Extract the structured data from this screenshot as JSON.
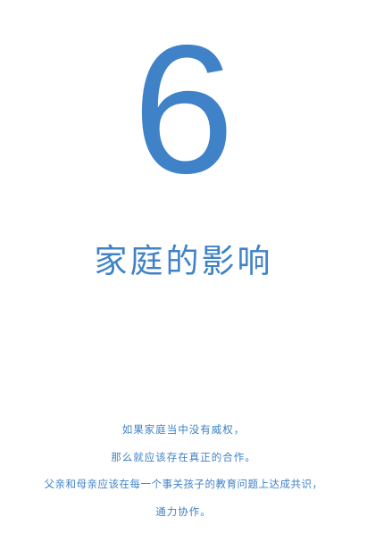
{
  "chapter": {
    "number": "6",
    "title": "家庭的影响"
  },
  "quote": {
    "lines": [
      "如果家庭当中没有威权，",
      "那么就应该存在真正的合作。",
      "父亲和母亲应该在每一个事关孩子的教育问题上达成共识，",
      "通力协作。"
    ]
  },
  "colors": {
    "accent": "#3f82c8",
    "background": "#ffffff"
  }
}
